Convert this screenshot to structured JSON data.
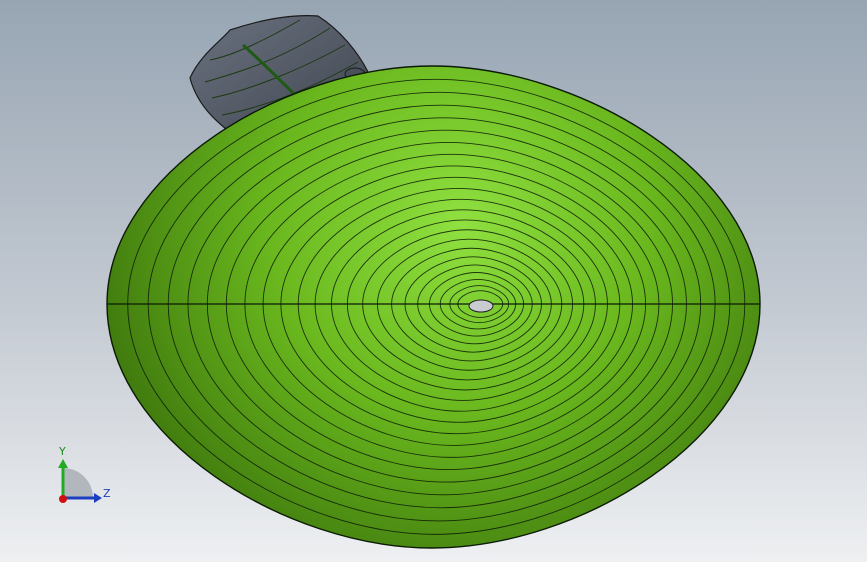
{
  "viewport": {
    "background_top": "#97a5b3",
    "background_bottom": "#eef0f2"
  },
  "model": {
    "body_color": "#6ab81e",
    "body_highlight": "#8fe040",
    "body_shadow": "#356a0a",
    "leaf_color": "#5c6370",
    "edge_color": "#0b1a05",
    "contour_count": 22
  },
  "triad": {
    "y_label": "Y",
    "z_label": "Z",
    "y_color": "#22aa22",
    "z_color": "#1c3fbf",
    "x_color": "#d01010"
  }
}
